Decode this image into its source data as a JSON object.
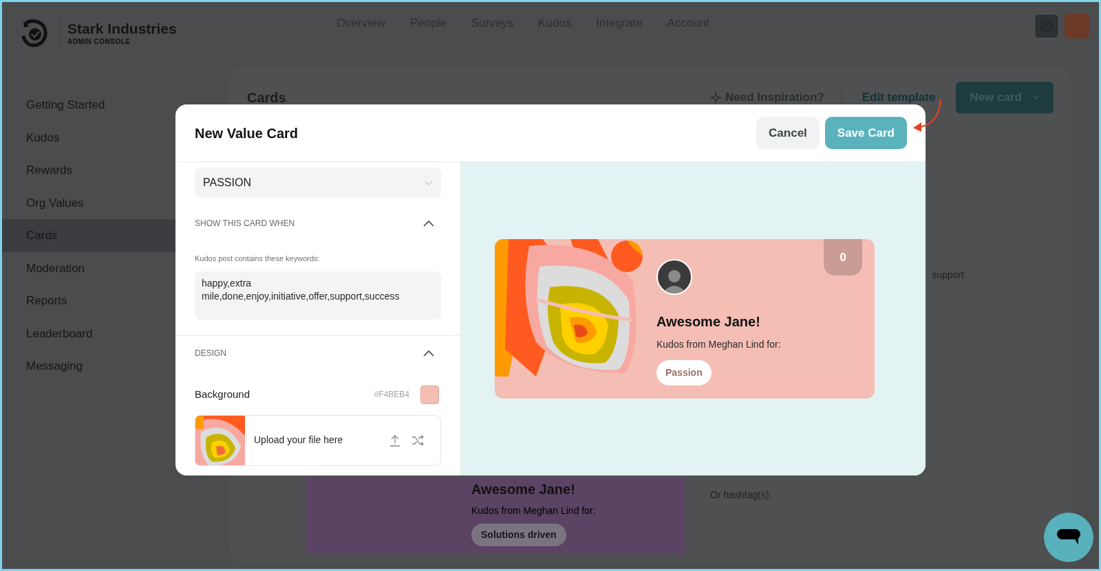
{
  "header": {
    "brand": "Stark Industries",
    "subtitle": "ADMIN CONSOLE",
    "nav": [
      {
        "label": "Overview"
      },
      {
        "label": "People"
      },
      {
        "label": "Surveys"
      },
      {
        "label": "Kudos"
      },
      {
        "label": "Integrate"
      },
      {
        "label": "Account"
      }
    ]
  },
  "sidebar": {
    "items": [
      {
        "label": "Getting Started",
        "selected": false
      },
      {
        "label": "Kudos",
        "selected": false
      },
      {
        "label": "Rewards",
        "selected": false
      },
      {
        "label": "Org Values",
        "selected": false
      },
      {
        "label": "Cards",
        "selected": true
      },
      {
        "label": "Moderation",
        "selected": false
      },
      {
        "label": "Reports",
        "selected": false
      },
      {
        "label": "Leaderboard",
        "selected": false
      },
      {
        "label": "Messaging",
        "selected": false
      }
    ]
  },
  "page": {
    "title": "Cards",
    "inspiration": "Need Inspiration?",
    "edit_template": "Edit template",
    "new_card": "New card",
    "keyword_fragment": "support",
    "hashtag_label": "Or hashtag(s):"
  },
  "background_card": {
    "title": "Awesome Jane!",
    "subtitle": "Kudos from Meghan Lind for:",
    "tag": "Solutions driven"
  },
  "modal": {
    "title": "New Value Card",
    "cancel": "Cancel",
    "save": "Save Card",
    "value_select": "PASSION",
    "show_section": {
      "title": "SHOW THIS CARD WHEN",
      "expanded": true
    },
    "keywords_label": "Kudos post contains these keywords:",
    "keywords": "happy,extra mile,done,enjoy,initiative,offer,support,success",
    "design_section": {
      "title": "DESIGN",
      "expanded": true
    },
    "background_label": "Background",
    "background_color": "#F4BEB4",
    "upload_label": "Upload your file here",
    "preview": {
      "counter": "0",
      "title": "Awesome Jane!",
      "subtitle": "Kudos from Meghan Lind for:",
      "tag": "Passion"
    }
  }
}
